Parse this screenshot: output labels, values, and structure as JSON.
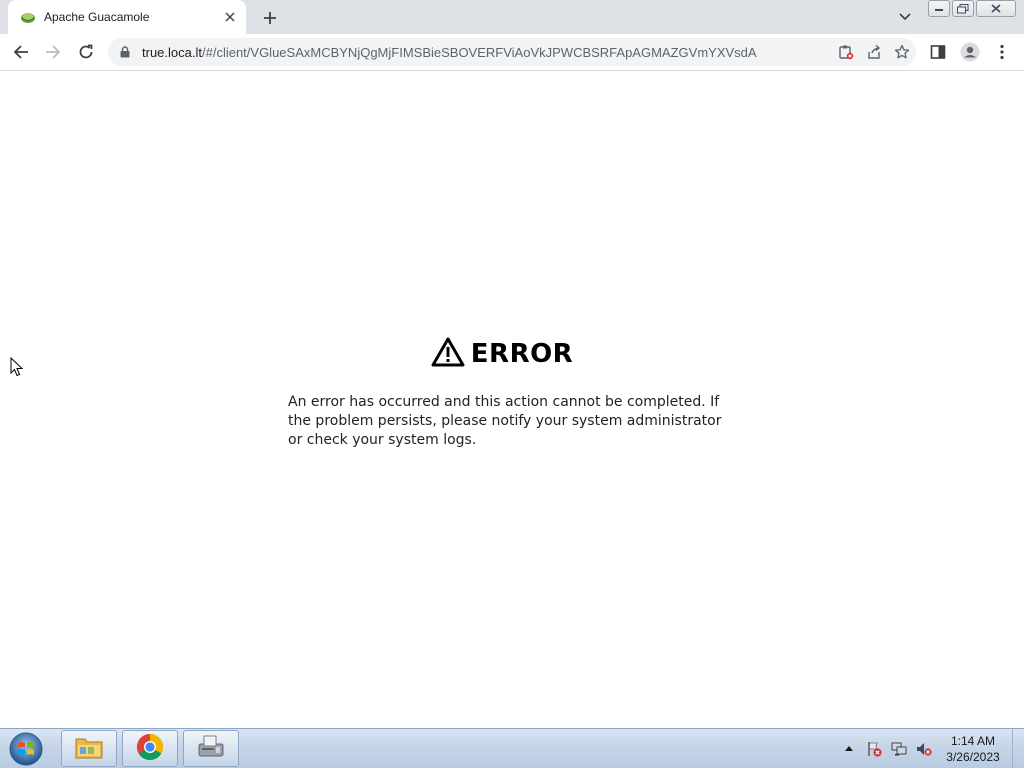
{
  "browser": {
    "tab": {
      "title": "Apache Guacamole"
    },
    "url": {
      "host": "true.loca.lt",
      "path": "/#/client/VGlueSAxMCBYNjQgMjFIMSBieSBOVERFViAoVkJPWCBSRFApAGMAZGVmYXVsdA"
    }
  },
  "page": {
    "error_title": "ERROR",
    "error_message": "An error has occurred and this action cannot be completed. If the problem persists, please notify your system administrator or check your system logs."
  },
  "taskbar": {
    "apps": [
      {
        "name": "Windows Explorer"
      },
      {
        "name": "Google Chrome"
      },
      {
        "name": "Fax"
      }
    ],
    "clock": {
      "time": "1:14 AM",
      "date": "3/26/2023"
    }
  },
  "colors": {
    "tabstrip": "#dee1e6",
    "omnibox": "#f1f3f4",
    "taskbar": "#c7d6e9",
    "accent_green": "#8bc34a"
  }
}
